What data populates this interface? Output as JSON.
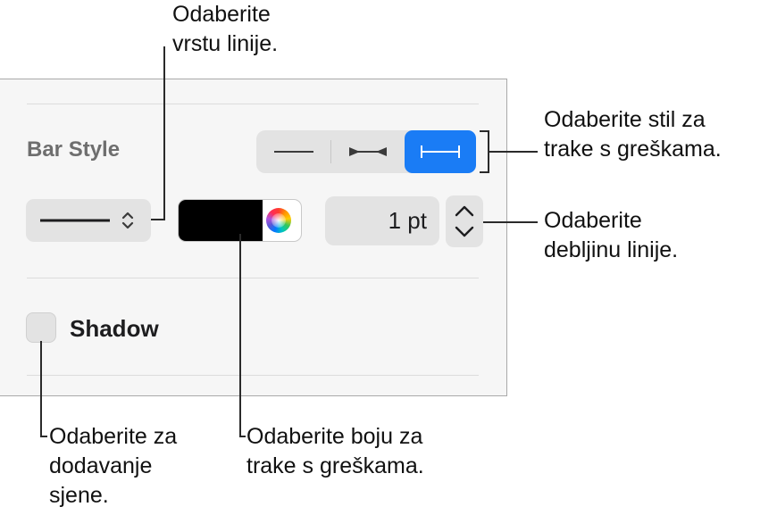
{
  "panel": {
    "bar_style_label": "Bar Style",
    "line_thickness_value": "1 pt",
    "shadow_label": "Shadow",
    "shadow_checked": false,
    "selected_bar_style_option": 3,
    "accent_color": "#1a7cf5",
    "swatch_color": "#000000"
  },
  "callouts": {
    "line_type": [
      "Odaberite",
      "vrstu linije."
    ],
    "bar_style": [
      "Odaberite stil za",
      "trake s greškama."
    ],
    "line_thickness": [
      "Odaberite",
      "debljinu linije."
    ],
    "shadow": [
      "Odaberite za",
      "dodavanje",
      "sjene."
    ],
    "color": [
      "Odaberite boju za",
      "trake s greškama."
    ]
  }
}
